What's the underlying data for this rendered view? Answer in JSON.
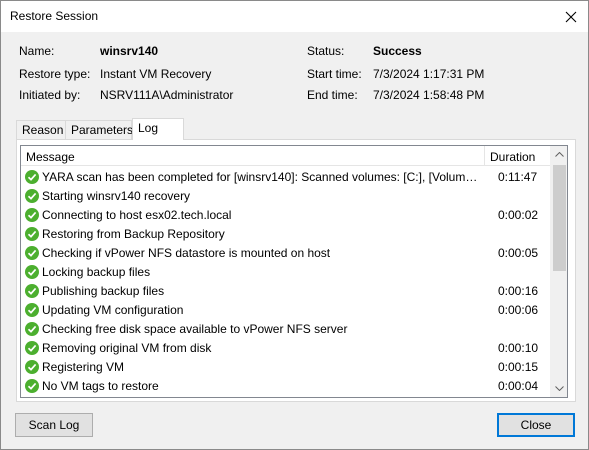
{
  "window": {
    "title": "Restore Session"
  },
  "info": {
    "name_label": "Name:",
    "name_value": "winsrv140",
    "restore_type_label": "Restore type:",
    "restore_type_value": "Instant VM Recovery",
    "initiated_by_label": "Initiated by:",
    "initiated_by_value": "NSRV111A\\Administrator",
    "status_label": "Status:",
    "status_value": "Success",
    "start_time_label": "Start time:",
    "start_time_value": "7/3/2024 1:17:31 PM",
    "end_time_label": "End time:",
    "end_time_value": "7/3/2024 1:58:48 PM"
  },
  "tabs": [
    {
      "label": "Reason"
    },
    {
      "label": "Parameters"
    },
    {
      "label": "Log"
    }
  ],
  "log": {
    "columns": {
      "message": "Message",
      "duration": "Duration"
    },
    "rows": [
      {
        "message": "YARA scan has been completed for [winsrv140]: Scanned volumes: [C:], [Volume{...",
        "duration": "0:11:47"
      },
      {
        "message": "Starting winsrv140 recovery",
        "duration": ""
      },
      {
        "message": "Connecting to host esx02.tech.local",
        "duration": "0:00:02"
      },
      {
        "message": "Restoring from Backup Repository",
        "duration": ""
      },
      {
        "message": "Checking if vPower NFS datastore is mounted on host",
        "duration": "0:00:05"
      },
      {
        "message": "Locking backup files",
        "duration": ""
      },
      {
        "message": "Publishing backup files",
        "duration": "0:00:16"
      },
      {
        "message": "Updating VM configuration",
        "duration": "0:00:06"
      },
      {
        "message": "Checking free disk space available to vPower NFS server",
        "duration": ""
      },
      {
        "message": "Removing original VM from disk",
        "duration": "0:00:10"
      },
      {
        "message": "Registering VM",
        "duration": "0:00:15"
      },
      {
        "message": "No VM tags to restore",
        "duration": "0:00:04"
      }
    ],
    "status_icon": "success-check-icon",
    "status_color": "#4caf2f"
  },
  "buttons": {
    "scan_log": "Scan Log",
    "close": "Close"
  },
  "colors": {
    "accent": "#0078d7"
  }
}
